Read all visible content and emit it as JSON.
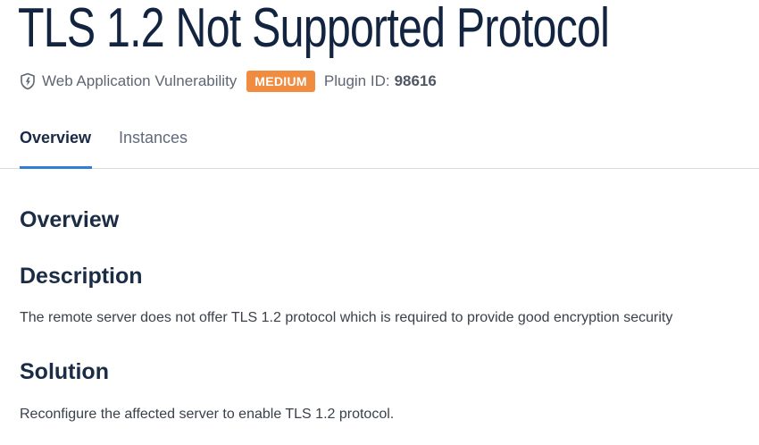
{
  "page_title": "TLS 1.2 Not Supported Protocol",
  "meta": {
    "icon": "shield-icon",
    "category": "Web Application Vulnerability",
    "severity": "MEDIUM",
    "severity_color": "#ef8c3f",
    "plugin_label": "Plugin ID:",
    "plugin_id": "98616"
  },
  "tabs": [
    {
      "label": "Overview",
      "active": true
    },
    {
      "label": "Instances",
      "active": false
    }
  ],
  "content": {
    "section_title": "Overview",
    "description_heading": "Description",
    "description_text": "The remote server does not offer TLS 1.2 protocol which is required to provide good encryption security",
    "solution_heading": "Solution",
    "solution_text": "Reconfigure the affected server to enable TLS 1.2 protocol."
  },
  "colors": {
    "accent": "#2f7fd6",
    "title": "#132440"
  }
}
